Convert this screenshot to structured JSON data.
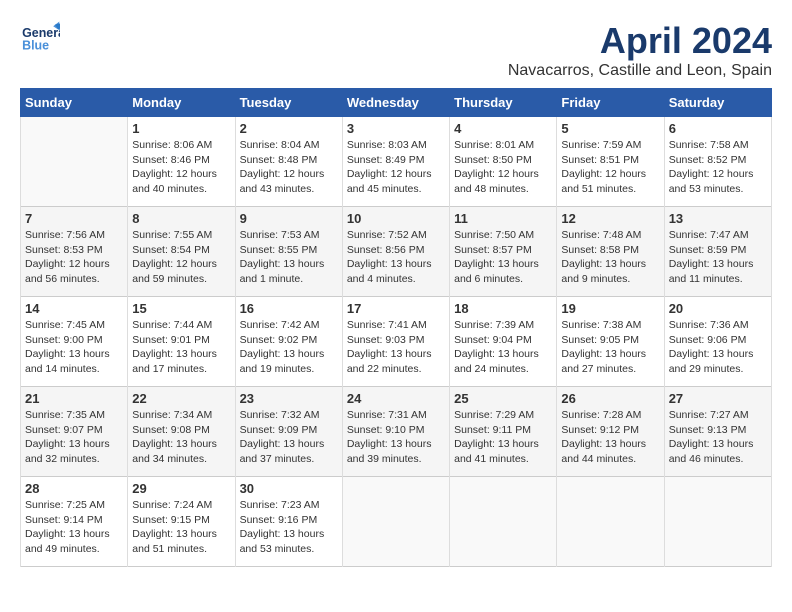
{
  "header": {
    "logo_general": "General",
    "logo_blue": "Blue",
    "title": "April 2024",
    "subtitle": "Navacarros, Castille and Leon, Spain"
  },
  "calendar": {
    "days_of_week": [
      "Sunday",
      "Monday",
      "Tuesday",
      "Wednesday",
      "Thursday",
      "Friday",
      "Saturday"
    ],
    "weeks": [
      [
        {
          "day": "",
          "content": ""
        },
        {
          "day": "1",
          "content": "Sunrise: 8:06 AM\nSunset: 8:46 PM\nDaylight: 12 hours\nand 40 minutes."
        },
        {
          "day": "2",
          "content": "Sunrise: 8:04 AM\nSunset: 8:48 PM\nDaylight: 12 hours\nand 43 minutes."
        },
        {
          "day": "3",
          "content": "Sunrise: 8:03 AM\nSunset: 8:49 PM\nDaylight: 12 hours\nand 45 minutes."
        },
        {
          "day": "4",
          "content": "Sunrise: 8:01 AM\nSunset: 8:50 PM\nDaylight: 12 hours\nand 48 minutes."
        },
        {
          "day": "5",
          "content": "Sunrise: 7:59 AM\nSunset: 8:51 PM\nDaylight: 12 hours\nand 51 minutes."
        },
        {
          "day": "6",
          "content": "Sunrise: 7:58 AM\nSunset: 8:52 PM\nDaylight: 12 hours\nand 53 minutes."
        }
      ],
      [
        {
          "day": "7",
          "content": "Sunrise: 7:56 AM\nSunset: 8:53 PM\nDaylight: 12 hours\nand 56 minutes."
        },
        {
          "day": "8",
          "content": "Sunrise: 7:55 AM\nSunset: 8:54 PM\nDaylight: 12 hours\nand 59 minutes."
        },
        {
          "day": "9",
          "content": "Sunrise: 7:53 AM\nSunset: 8:55 PM\nDaylight: 13 hours\nand 1 minute."
        },
        {
          "day": "10",
          "content": "Sunrise: 7:52 AM\nSunset: 8:56 PM\nDaylight: 13 hours\nand 4 minutes."
        },
        {
          "day": "11",
          "content": "Sunrise: 7:50 AM\nSunset: 8:57 PM\nDaylight: 13 hours\nand 6 minutes."
        },
        {
          "day": "12",
          "content": "Sunrise: 7:48 AM\nSunset: 8:58 PM\nDaylight: 13 hours\nand 9 minutes."
        },
        {
          "day": "13",
          "content": "Sunrise: 7:47 AM\nSunset: 8:59 PM\nDaylight: 13 hours\nand 11 minutes."
        }
      ],
      [
        {
          "day": "14",
          "content": "Sunrise: 7:45 AM\nSunset: 9:00 PM\nDaylight: 13 hours\nand 14 minutes."
        },
        {
          "day": "15",
          "content": "Sunrise: 7:44 AM\nSunset: 9:01 PM\nDaylight: 13 hours\nand 17 minutes."
        },
        {
          "day": "16",
          "content": "Sunrise: 7:42 AM\nSunset: 9:02 PM\nDaylight: 13 hours\nand 19 minutes."
        },
        {
          "day": "17",
          "content": "Sunrise: 7:41 AM\nSunset: 9:03 PM\nDaylight: 13 hours\nand 22 minutes."
        },
        {
          "day": "18",
          "content": "Sunrise: 7:39 AM\nSunset: 9:04 PM\nDaylight: 13 hours\nand 24 minutes."
        },
        {
          "day": "19",
          "content": "Sunrise: 7:38 AM\nSunset: 9:05 PM\nDaylight: 13 hours\nand 27 minutes."
        },
        {
          "day": "20",
          "content": "Sunrise: 7:36 AM\nSunset: 9:06 PM\nDaylight: 13 hours\nand 29 minutes."
        }
      ],
      [
        {
          "day": "21",
          "content": "Sunrise: 7:35 AM\nSunset: 9:07 PM\nDaylight: 13 hours\nand 32 minutes."
        },
        {
          "day": "22",
          "content": "Sunrise: 7:34 AM\nSunset: 9:08 PM\nDaylight: 13 hours\nand 34 minutes."
        },
        {
          "day": "23",
          "content": "Sunrise: 7:32 AM\nSunset: 9:09 PM\nDaylight: 13 hours\nand 37 minutes."
        },
        {
          "day": "24",
          "content": "Sunrise: 7:31 AM\nSunset: 9:10 PM\nDaylight: 13 hours\nand 39 minutes."
        },
        {
          "day": "25",
          "content": "Sunrise: 7:29 AM\nSunset: 9:11 PM\nDaylight: 13 hours\nand 41 minutes."
        },
        {
          "day": "26",
          "content": "Sunrise: 7:28 AM\nSunset: 9:12 PM\nDaylight: 13 hours\nand 44 minutes."
        },
        {
          "day": "27",
          "content": "Sunrise: 7:27 AM\nSunset: 9:13 PM\nDaylight: 13 hours\nand 46 minutes."
        }
      ],
      [
        {
          "day": "28",
          "content": "Sunrise: 7:25 AM\nSunset: 9:14 PM\nDaylight: 13 hours\nand 49 minutes."
        },
        {
          "day": "29",
          "content": "Sunrise: 7:24 AM\nSunset: 9:15 PM\nDaylight: 13 hours\nand 51 minutes."
        },
        {
          "day": "30",
          "content": "Sunrise: 7:23 AM\nSunset: 9:16 PM\nDaylight: 13 hours\nand 53 minutes."
        },
        {
          "day": "",
          "content": ""
        },
        {
          "day": "",
          "content": ""
        },
        {
          "day": "",
          "content": ""
        },
        {
          "day": "",
          "content": ""
        }
      ]
    ]
  }
}
